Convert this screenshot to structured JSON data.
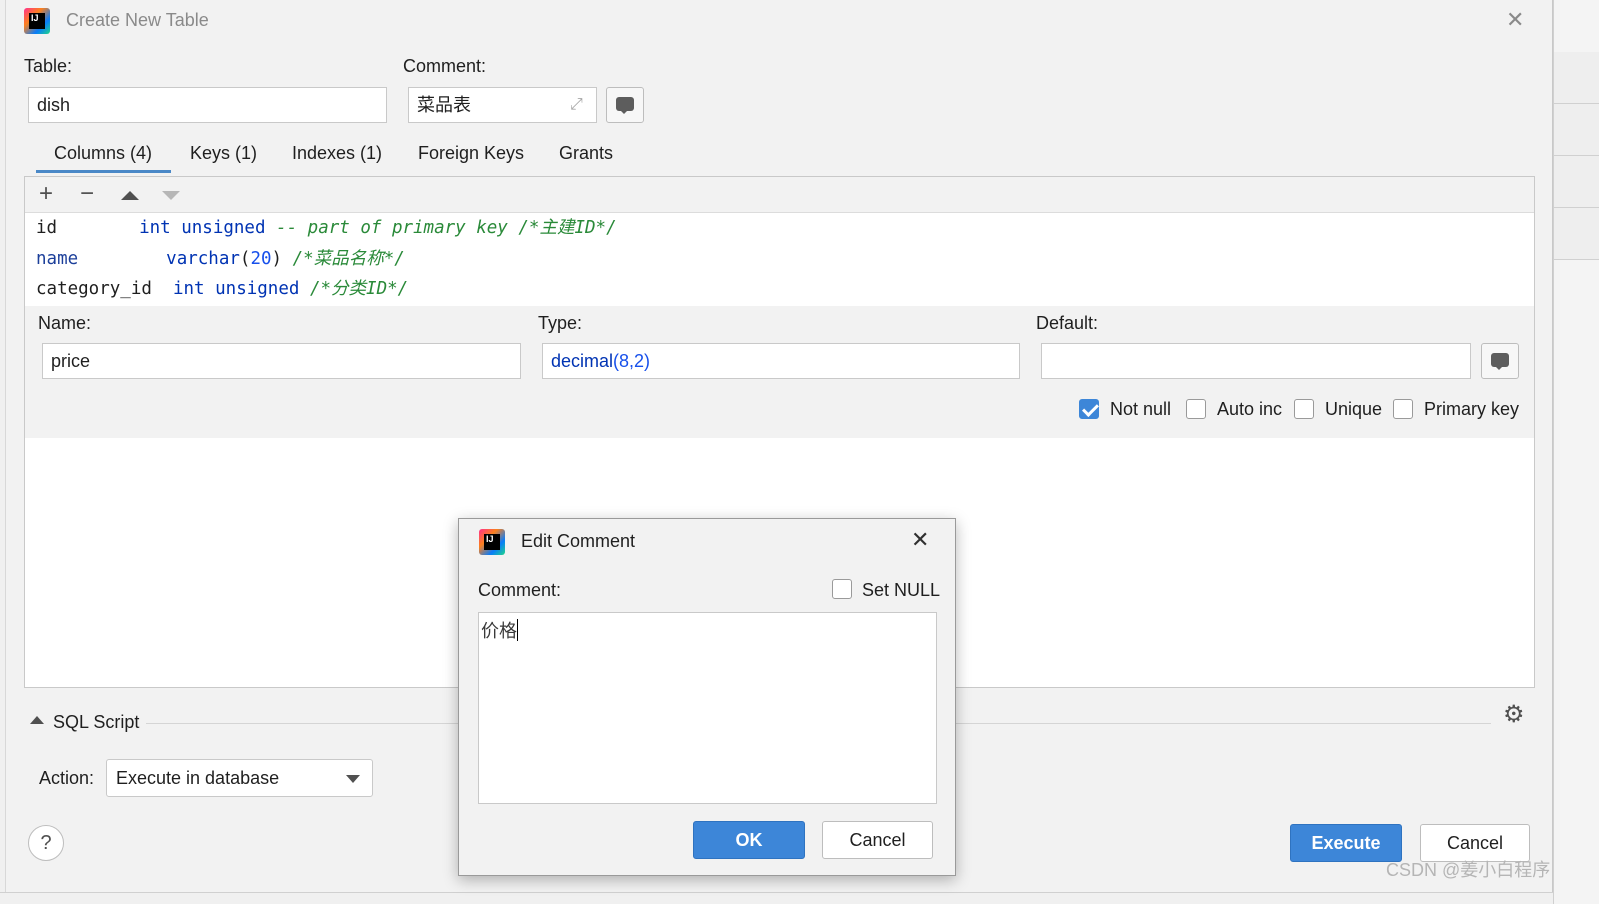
{
  "dialog": {
    "title": "Create New Table",
    "table_label": "Table:",
    "table_value": "dish",
    "comment_label": "Comment:",
    "comment_value": "菜品表"
  },
  "tabs": [
    {
      "label": "Columns (4)",
      "active": true
    },
    {
      "label": "Keys (1)"
    },
    {
      "label": "Indexes (1)"
    },
    {
      "label": "Foreign Keys"
    },
    {
      "label": "Grants"
    }
  ],
  "columns": [
    {
      "name": "id",
      "type": "int unsigned",
      "extra": " -- part of primary key",
      "comment": "/*主建ID*/"
    },
    {
      "name": "name",
      "type_kw": "varchar",
      "type_open": "(",
      "type_num": "20",
      "type_close": ")",
      "comment": "/*菜品名称*/"
    },
    {
      "name": "category_id",
      "type": "int unsigned",
      "comment": "/*分类ID*/"
    }
  ],
  "column_editor": {
    "name_label": "Name:",
    "name_value": "price",
    "type_label": "Type:",
    "type_kw": "decimal",
    "type_args": "(8,2)",
    "default_label": "Default:",
    "default_value": "",
    "checkboxes": [
      {
        "label": "Not null",
        "checked": true
      },
      {
        "label": "Auto inc",
        "checked": false
      },
      {
        "label": "Unique",
        "checked": false
      },
      {
        "label": "Primary key",
        "checked": false
      }
    ]
  },
  "sql_script": {
    "label": "SQL Script",
    "action_label": "Action:",
    "action_value": "Execute in database"
  },
  "footer": {
    "help": "?",
    "execute": "Execute",
    "cancel": "Cancel"
  },
  "edit_comment": {
    "title": "Edit Comment",
    "comment_label": "Comment:",
    "set_null_label": "Set NULL",
    "set_null_checked": false,
    "value": "价格",
    "ok": "OK",
    "cancel": "Cancel"
  },
  "watermark": "CSDN @姜小白程序",
  "icons": [
    "app-logo-icon",
    "close-icon",
    "expand-icon",
    "comment-icon",
    "plus-icon",
    "minus-icon",
    "move-up-icon",
    "move-down-icon",
    "collapse-icon",
    "gear-icon",
    "chevron-down-icon",
    "help-icon"
  ],
  "colors": {
    "accent": "#3d86d8",
    "keyword": "#0033b3",
    "comment": "#2a8a39"
  }
}
